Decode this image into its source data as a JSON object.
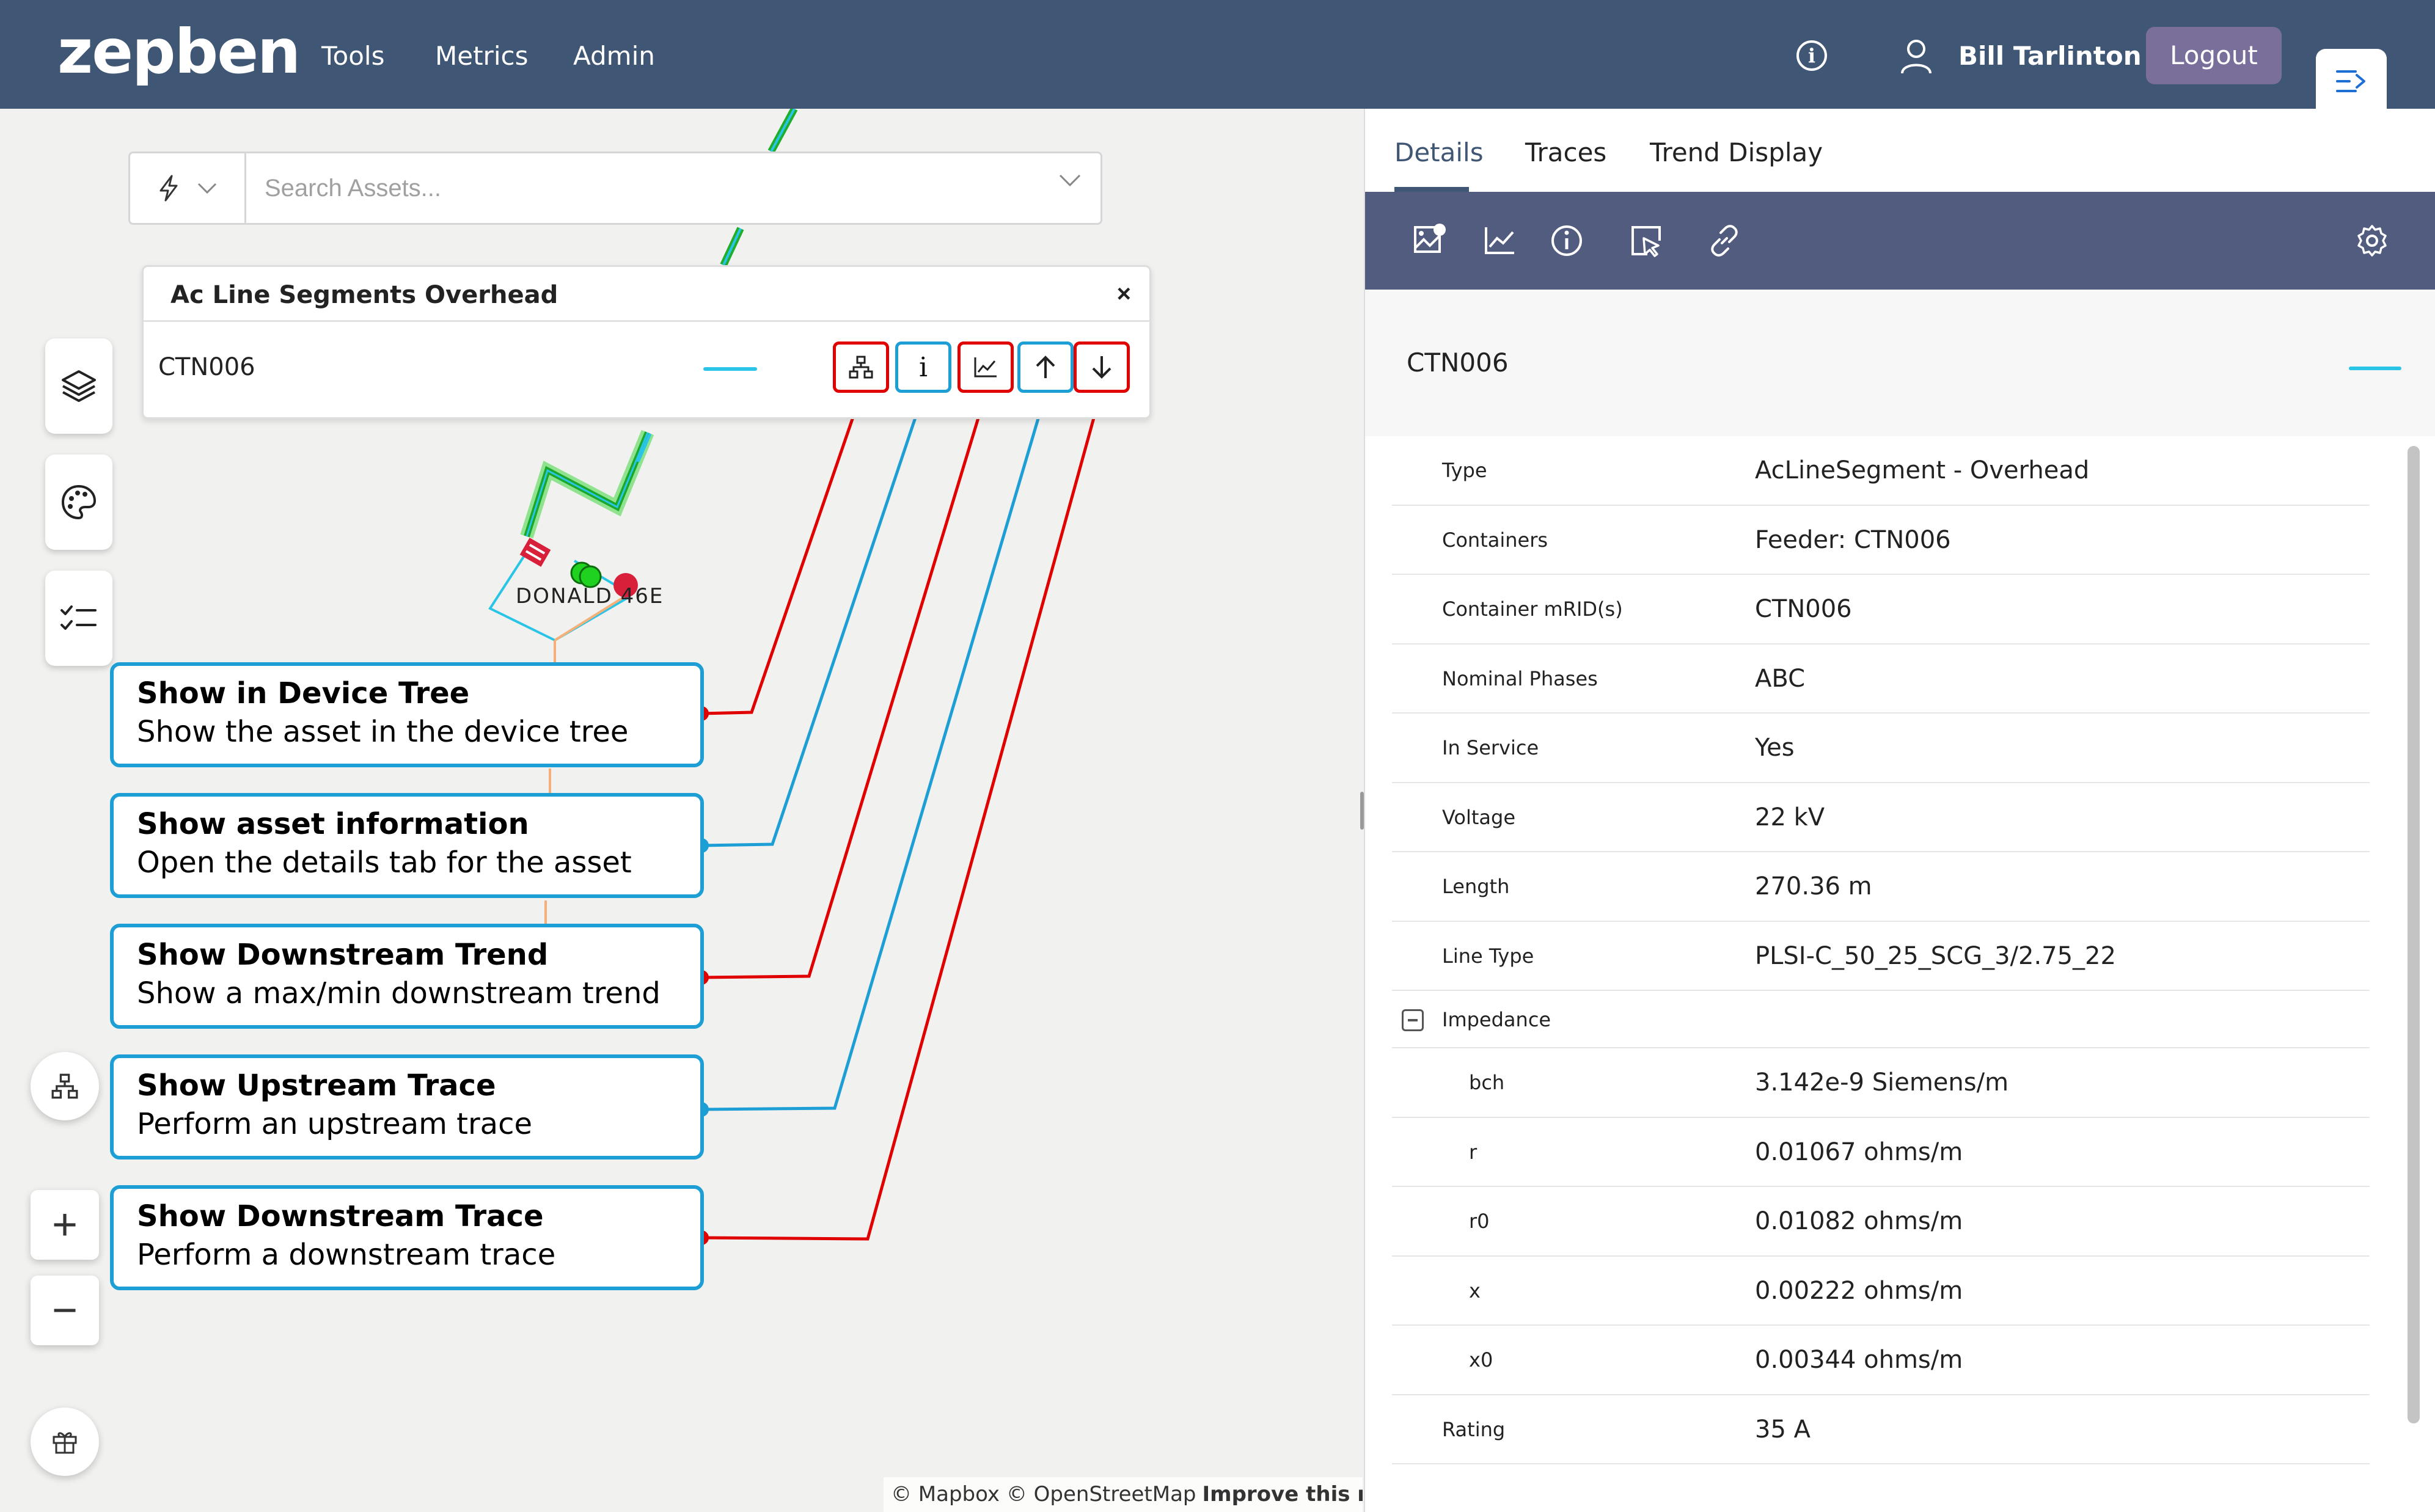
{
  "header": {
    "logo": "zepben",
    "nav": [
      "Tools",
      "Metrics",
      "Admin"
    ],
    "user_name": "Bill Tarlinton",
    "logout_label": "Logout",
    "bg_color": "#3f5674"
  },
  "search": {
    "placeholder": "Search Assets...",
    "filter_icon": "lightning-icon"
  },
  "popup": {
    "title": "Ac Line Segments Overhead",
    "close": "×",
    "asset_name": "CTN006",
    "info_label": "i",
    "buttons": [
      "device-tree",
      "info",
      "downstream-trend",
      "upstream-trace",
      "downstream-trace"
    ]
  },
  "callouts": [
    {
      "title": "Show in Device Tree",
      "desc": "Show the asset in the device tree",
      "color": "#e00000"
    },
    {
      "title": "Show asset information",
      "desc": "Open the details tab for the asset",
      "color": "#1d9fd6"
    },
    {
      "title": "Show Downstream Trend",
      "desc": "Show a max/min downstream trend",
      "color": "#e00000"
    },
    {
      "title": "Show Upstream Trace",
      "desc": "Perform an upstream trace",
      "color": "#1d9fd6"
    },
    {
      "title": "Show Downstream Trace",
      "desc": "Perform a downstream trace",
      "color": "#e00000"
    }
  ],
  "map": {
    "node_label": "DONALD 46E",
    "attribution": "© Mapbox © OpenStreetMap",
    "improve_link": "Improve this map",
    "zoom_in": "+",
    "zoom_out": "−"
  },
  "panel": {
    "tabs": [
      "Details",
      "Traces",
      "Trend Display"
    ],
    "active_tab": "Details",
    "asset_name": "CTN006",
    "properties": [
      {
        "label": "Type",
        "value": "AcLineSegment - Overhead"
      },
      {
        "label": "Containers",
        "value": "Feeder: CTN006"
      },
      {
        "label": "Container mRID(s)",
        "value": "CTN006"
      },
      {
        "label": "Nominal Phases",
        "value": "ABC"
      },
      {
        "label": "In Service",
        "value": "Yes"
      },
      {
        "label": "Voltage",
        "value": "22 kV"
      },
      {
        "label": "Length",
        "value": "270.36 m"
      },
      {
        "label": "Line Type",
        "value": "PLSI-C_50_25_SCG_3/2.75_22"
      }
    ],
    "impedance_group": "Impedance",
    "impedance": [
      {
        "label": "bch",
        "value": "3.142e-9 Siemens/m"
      },
      {
        "label": "r",
        "value": "0.01067 ohms/m"
      },
      {
        "label": "r0",
        "value": "0.01082 ohms/m"
      },
      {
        "label": "x",
        "value": "0.00222 ohms/m"
      },
      {
        "label": "x0",
        "value": "0.00344 ohms/m"
      }
    ],
    "rating": {
      "label": "Rating",
      "value": "35 A"
    }
  }
}
